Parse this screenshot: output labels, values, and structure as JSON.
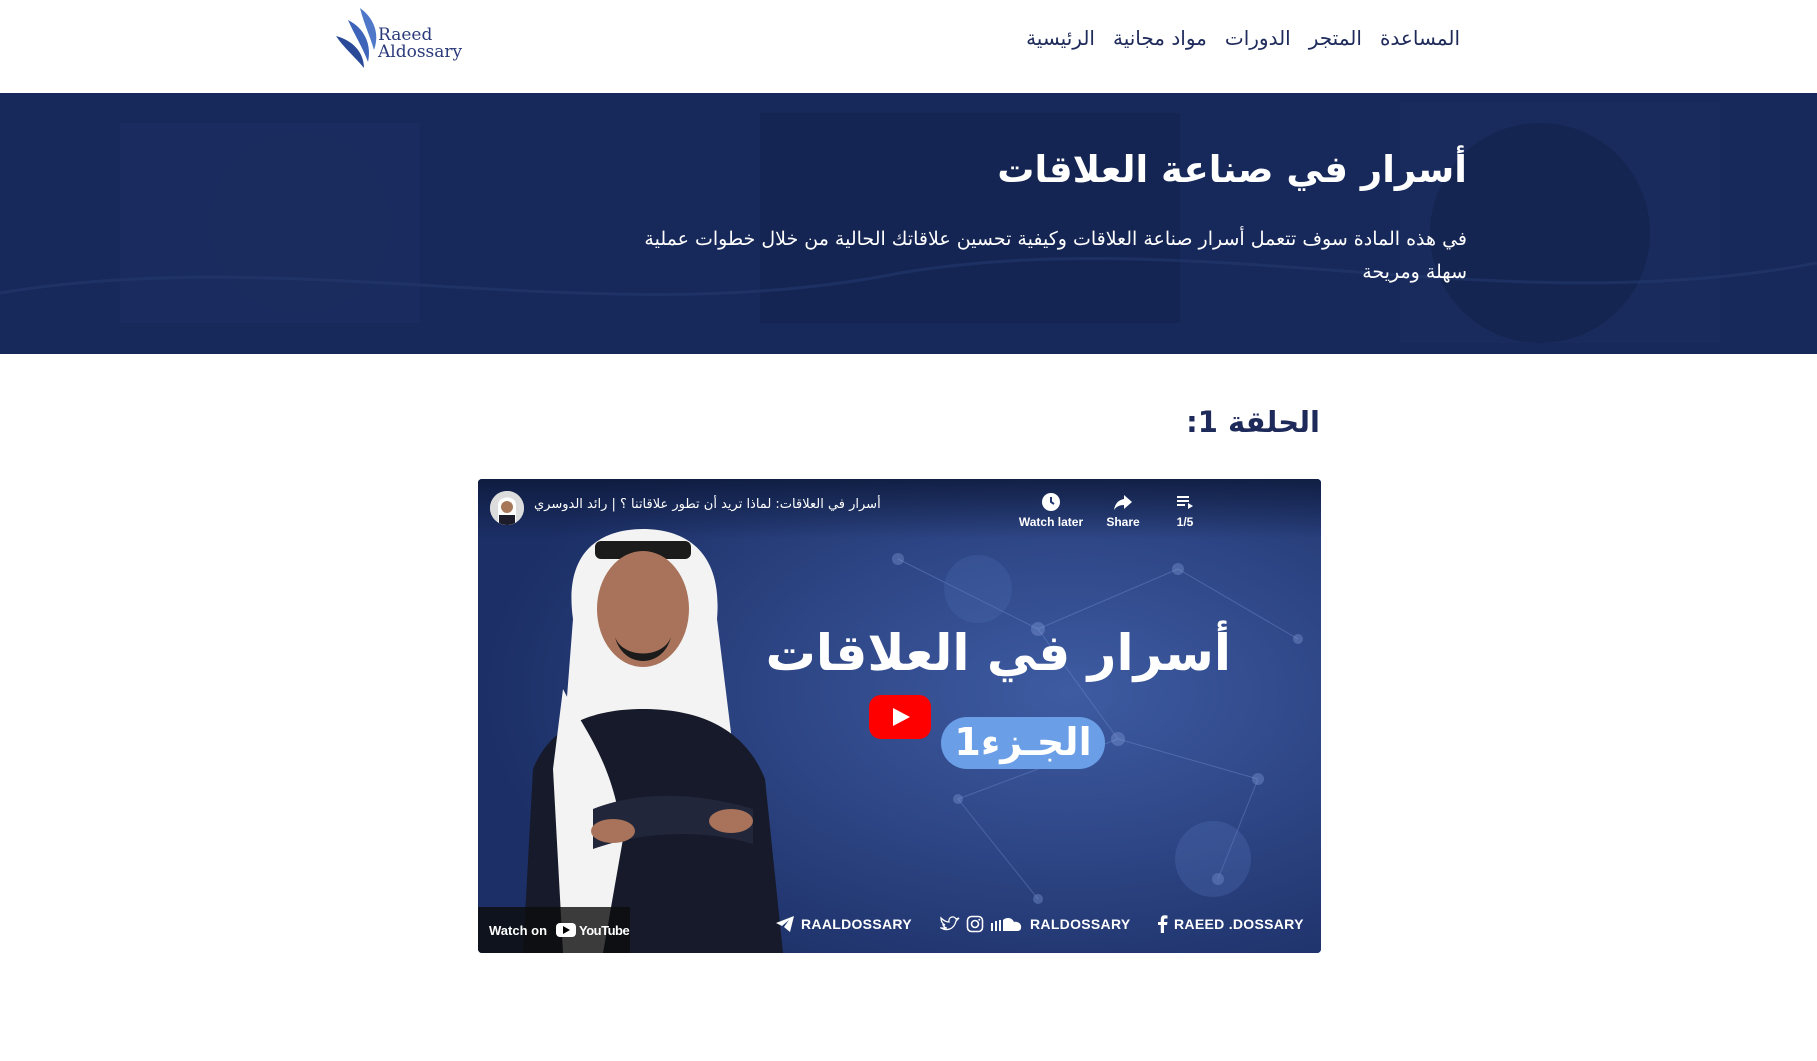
{
  "brand": {
    "line1": "Raeed",
    "line2": "Aldossary",
    "color": "#2b3a7a"
  },
  "nav": {
    "items": [
      "الرئيسية",
      "مواد مجانية",
      "الدورات",
      "المتجر",
      "المساعدة"
    ]
  },
  "hero": {
    "title": "أسرار في صناعة العلاقات",
    "description_line1": "في هذه المادة سوف تتعمل أسرار صناعة العلاقات وكيفية تحسين علاقاتك الحالية من خلال خطوات عملية",
    "description_line2": "سهلة ومريحة",
    "background": "#17285a"
  },
  "episode": {
    "title": "الحلقة 1:"
  },
  "video": {
    "title": "أسرار في العلاقات: لماذا تريد أن تطور علاقاتنا ؟ | رائد الدوسري",
    "watch_later_label": "Watch later",
    "share_label": "Share",
    "playlist_position": "1/5",
    "thumbnail_title": "أسرار في العلاقات",
    "part_label": "الجـزء1",
    "watch_on_label": "Watch on",
    "youtube_label": "YouTube",
    "social": {
      "telegram": "RAALDOSSARY",
      "multi": "RALDOSSARY",
      "facebook": "RAEED .DOSSARY"
    },
    "colors": {
      "play": "#ff0000",
      "pill": "#6a9ee6"
    }
  }
}
